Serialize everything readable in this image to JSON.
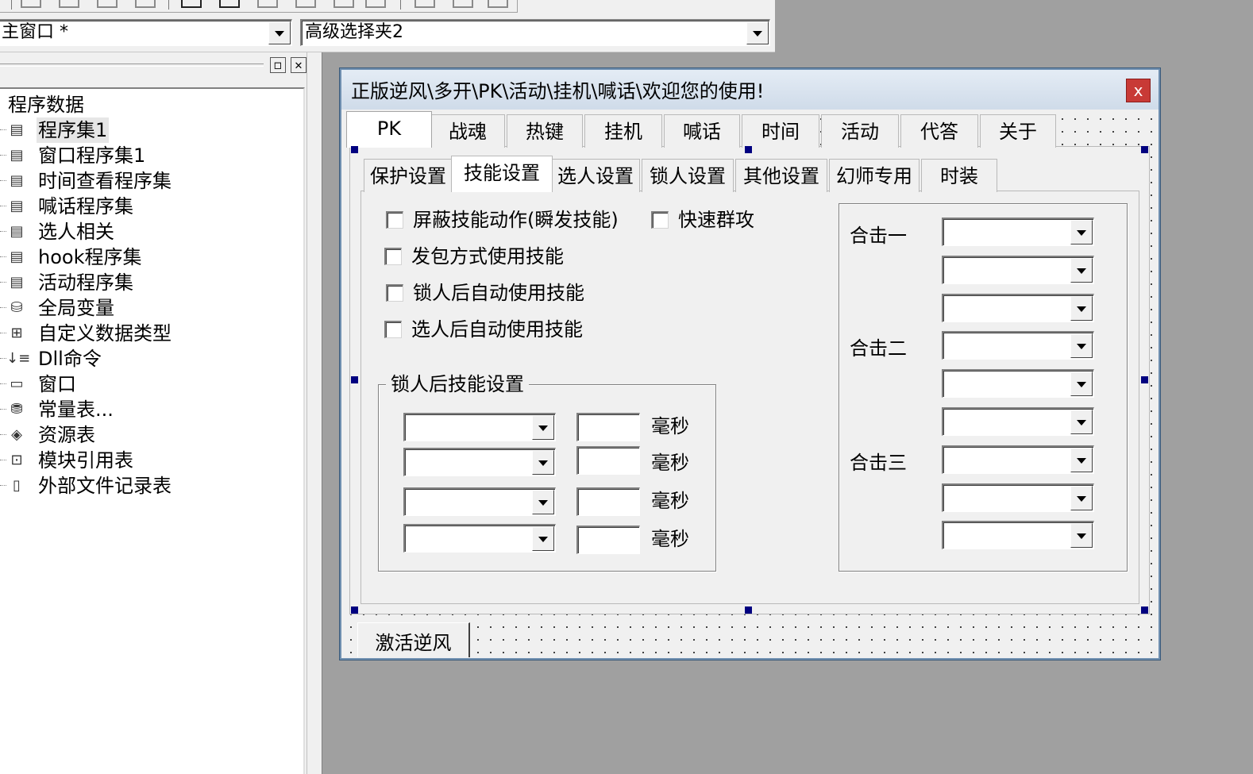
{
  "toolbar": {
    "window_selector": "主窗口 *",
    "component_selector": "高级选择夹2"
  },
  "panel": {
    "restore_glyph": "◻",
    "close_glyph": "✕"
  },
  "tree": {
    "root": "程序数据",
    "items": [
      {
        "label": "程序集1",
        "icon": "module-icon"
      },
      {
        "label": "窗口程序集1",
        "icon": "module-icon"
      },
      {
        "label": "时间查看程序集",
        "icon": "module-icon"
      },
      {
        "label": "喊话程序集",
        "icon": "module-icon"
      },
      {
        "label": "选人相关",
        "icon": "module-icon"
      },
      {
        "label": "hook程序集",
        "icon": "module-icon"
      },
      {
        "label": "活动程序集",
        "icon": "module-icon"
      },
      {
        "label": "全局变量",
        "icon": "global-variable-icon"
      },
      {
        "label": "自定义数据类型",
        "icon": "datatype-icon"
      },
      {
        "label": "Dll命令",
        "icon": "dll-icon"
      },
      {
        "label": "窗口",
        "icon": "window-icon"
      },
      {
        "label": "常量表...",
        "icon": "constant-icon"
      },
      {
        "label": "资源表",
        "icon": "resource-icon"
      },
      {
        "label": "模块引用表",
        "icon": "module-ref-icon"
      },
      {
        "label": "外部文件记录表",
        "icon": "external-file-icon"
      }
    ]
  },
  "design_window": {
    "title": "正版逆风\\多开\\PK\\活动\\挂机\\喊话\\欢迎您的使用!",
    "close_label": "x",
    "outer_tabs": [
      "PK",
      "战魂",
      "热键",
      "挂机",
      "喊话",
      "时间",
      "活动",
      "代答",
      "关于"
    ],
    "active_outer_tab": "PK",
    "inner_tabs": [
      "保护设置",
      "技能设置",
      "选人设置",
      "锁人设置",
      "其他设置",
      "幻师专用",
      "时装"
    ],
    "active_inner_tab": "技能设置",
    "checkboxes": {
      "block_skill_anim": "屏蔽技能动作(瞬发技能)",
      "quick_aoe": "快速群攻",
      "packet_skill": "发包方式使用技能",
      "lock_auto_skill": "锁人后自动使用技能",
      "select_auto_skill": "选人后自动使用技能"
    },
    "lock_group": {
      "title": "锁人后技能设置",
      "unit": "毫秒",
      "rows": 4
    },
    "combo_group": {
      "labels": [
        "合击一",
        "合击二",
        "合击三"
      ]
    },
    "activate_button": "激活逆风"
  }
}
